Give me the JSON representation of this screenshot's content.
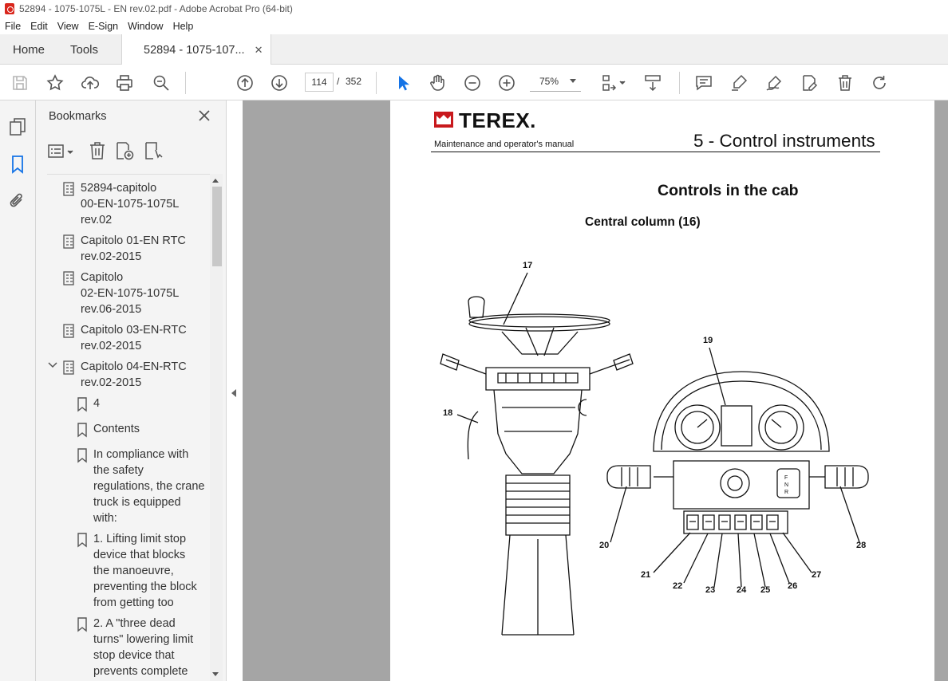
{
  "window": {
    "title": "52894 - 1075-1075L - EN rev.02.pdf - Adobe Acrobat Pro (64-bit)"
  },
  "menu": [
    "File",
    "Edit",
    "View",
    "E-Sign",
    "Window",
    "Help"
  ],
  "tabs": {
    "home": "Home",
    "tools": "Tools",
    "document": "52894 - 1075-107..."
  },
  "toolbar": {
    "page_current": "114",
    "page_separator": "/",
    "page_total": "352",
    "zoom": "75%"
  },
  "bookmarks": {
    "title": "Bookmarks",
    "items": [
      {
        "label": "52894-capitolo 00-EN-1075-1075L rev.02",
        "lines": [
          "52894-capitolo",
          "00-EN-1075-1075L",
          "rev.02"
        ],
        "type": "document"
      },
      {
        "label": "Capitolo 01-EN RTC rev.02-2015",
        "lines": [
          "Capitolo 01-EN RTC",
          "rev.02-2015"
        ],
        "type": "document"
      },
      {
        "label": "Capitolo 02-EN-1075-1075L rev.06-2015",
        "lines": [
          "Capitolo",
          "02-EN-1075-1075L",
          "rev.06-2015"
        ],
        "type": "document"
      },
      {
        "label": "Capitolo 03-EN-RTC rev.02-2015",
        "lines": [
          "Capitolo 03-EN-RTC",
          "rev.02-2015"
        ],
        "type": "document"
      },
      {
        "label": "Capitolo 04-EN-RTC rev.02-2015",
        "lines": [
          "Capitolo 04-EN-RTC",
          "rev.02-2015"
        ],
        "type": "document",
        "expanded": true
      },
      {
        "label": "4",
        "lines": [
          "4"
        ],
        "type": "bookmark"
      },
      {
        "label": "Contents",
        "lines": [
          "Contents"
        ],
        "type": "bookmark"
      },
      {
        "label": "In compliance with the safety regulations, the crane truck is equipped with:",
        "lines": [
          "In compliance with",
          "the safety",
          "regulations, the crane",
          "truck is equipped",
          "with:"
        ],
        "type": "bookmark"
      },
      {
        "label": "1. Lifting limit stop device that blocks the manoeuvre, preventing the block from getting too",
        "lines": [
          "1. Lifting limit stop",
          "device that blocks",
          "the manoeuvre,",
          "preventing the block",
          "from getting too"
        ],
        "type": "bookmark"
      },
      {
        "label": "2. A \"three dead turns\" lowering limit stop device that prevents complete",
        "lines": [
          "2. A \"three dead",
          "turns\" lowering limit",
          "stop device that",
          "prevents complete"
        ],
        "type": "bookmark"
      }
    ]
  },
  "page": {
    "brand": "TEREX.",
    "subtitle": "Maintenance and operator's manual",
    "chapter": "5 - Control instruments",
    "heading": "Controls in the cab",
    "subheading": "Central column (16)",
    "callouts": [
      "17",
      "18",
      "19",
      "20",
      "21",
      "22",
      "23",
      "24",
      "25",
      "26",
      "27",
      "28"
    ],
    "gear_letters": [
      "F",
      "N",
      "R"
    ]
  },
  "colors": {
    "terex_red": "#c8191d",
    "doc_background": "#a5a5a5",
    "select_blue": "#1473e6"
  }
}
